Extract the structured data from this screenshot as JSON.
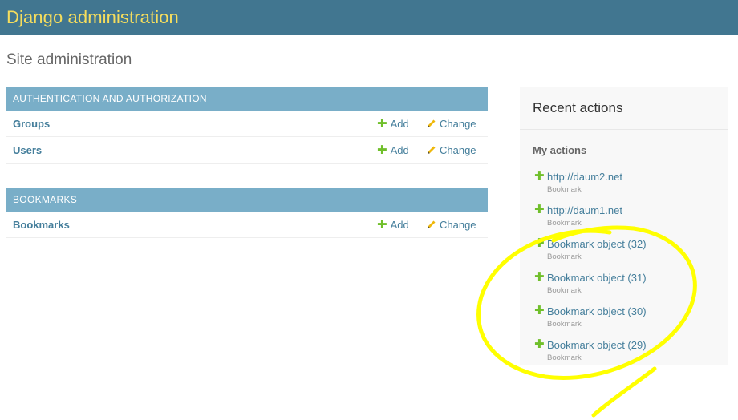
{
  "header": {
    "brand": "Django administration"
  },
  "page": {
    "title": "Site administration"
  },
  "modules": [
    {
      "caption": "AUTHENTICATION AND AUTHORIZATION",
      "models": [
        {
          "name": "Groups",
          "add": "Add",
          "change": "Change"
        },
        {
          "name": "Users",
          "add": "Add",
          "change": "Change"
        }
      ]
    },
    {
      "caption": "BOOKMARKS",
      "models": [
        {
          "name": "Bookmarks",
          "add": "Add",
          "change": "Change"
        }
      ]
    }
  ],
  "recent": {
    "title": "Recent actions",
    "subtitle": "My actions",
    "items": [
      {
        "label": "http://daum2.net",
        "type": "Bookmark"
      },
      {
        "label": "http://daum1.net",
        "type": "Bookmark"
      },
      {
        "label": "Bookmark object (32)",
        "type": "Bookmark"
      },
      {
        "label": "Bookmark object (31)",
        "type": "Bookmark"
      },
      {
        "label": "Bookmark object (30)",
        "type": "Bookmark"
      },
      {
        "label": "Bookmark object (29)",
        "type": "Bookmark"
      }
    ]
  },
  "icons": {
    "add": "plus-icon",
    "change": "pencil-icon"
  },
  "colors": {
    "header_bg": "#417690",
    "brand": "#f5dd5d",
    "caption_bg": "#79aec8",
    "link": "#447e9b",
    "add_green": "#70bf2b",
    "annotation": "#ffff00"
  }
}
